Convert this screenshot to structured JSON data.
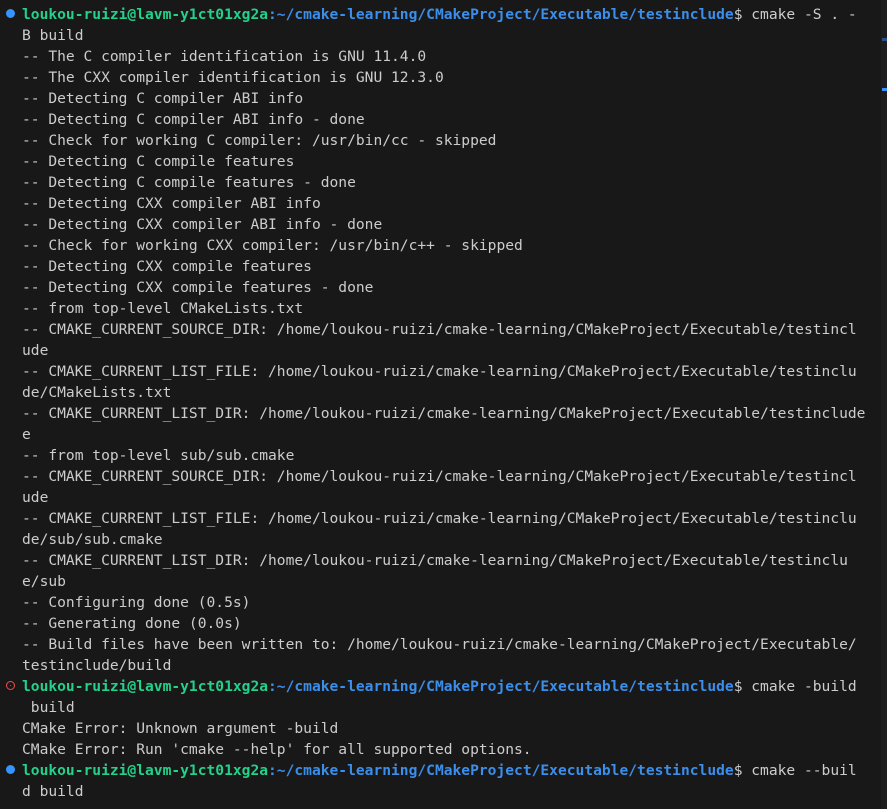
{
  "prompt": {
    "user_host": "loukou-ruizi@lavm-y1ct01xg2a",
    "path": ":~/cmake-learning/CMakeProject/Executable/testinclude",
    "dollar": "$"
  },
  "colors": {
    "prompt_user": "#23d18b",
    "prompt_path": "#3b8eea",
    "text": "#cccccc",
    "background": "#181818",
    "status_ok": "#3794ff",
    "status_error": "#f14c4c"
  },
  "lines": [
    {
      "kind": "prompt",
      "status": "ok",
      "command": " cmake -S . -"
    },
    {
      "kind": "out",
      "text": "B build"
    },
    {
      "kind": "out",
      "text": "-- The C compiler identification is GNU 11.4.0"
    },
    {
      "kind": "out",
      "text": "-- The CXX compiler identification is GNU 12.3.0"
    },
    {
      "kind": "out",
      "text": "-- Detecting C compiler ABI info"
    },
    {
      "kind": "out",
      "text": "-- Detecting C compiler ABI info - done"
    },
    {
      "kind": "out",
      "text": "-- Check for working C compiler: /usr/bin/cc - skipped"
    },
    {
      "kind": "out",
      "text": "-- Detecting C compile features"
    },
    {
      "kind": "out",
      "text": "-- Detecting C compile features - done"
    },
    {
      "kind": "out",
      "text": "-- Detecting CXX compiler ABI info"
    },
    {
      "kind": "out",
      "text": "-- Detecting CXX compiler ABI info - done"
    },
    {
      "kind": "out",
      "text": "-- Check for working CXX compiler: /usr/bin/c++ - skipped"
    },
    {
      "kind": "out",
      "text": "-- Detecting CXX compile features"
    },
    {
      "kind": "out",
      "text": "-- Detecting CXX compile features - done"
    },
    {
      "kind": "out",
      "text": "-- from top-level CMakeLists.txt"
    },
    {
      "kind": "out",
      "text": "-- CMAKE_CURRENT_SOURCE_DIR: /home/loukou-ruizi/cmake-learning/CMakeProject/Executable/testincl"
    },
    {
      "kind": "out",
      "text": "ude"
    },
    {
      "kind": "out",
      "text": "-- CMAKE_CURRENT_LIST_FILE: /home/loukou-ruizi/cmake-learning/CMakeProject/Executable/testinclu"
    },
    {
      "kind": "out",
      "text": "de/CMakeLists.txt"
    },
    {
      "kind": "out",
      "text": "-- CMAKE_CURRENT_LIST_DIR: /home/loukou-ruizi/cmake-learning/CMakeProject/Executable/testinclude"
    },
    {
      "kind": "out",
      "text": "e"
    },
    {
      "kind": "out",
      "text": "-- from top-level sub/sub.cmake"
    },
    {
      "kind": "out",
      "text": "-- CMAKE_CURRENT_SOURCE_DIR: /home/loukou-ruizi/cmake-learning/CMakeProject/Executable/testincl"
    },
    {
      "kind": "out",
      "text": "ude"
    },
    {
      "kind": "out",
      "text": "-- CMAKE_CURRENT_LIST_FILE: /home/loukou-ruizi/cmake-learning/CMakeProject/Executable/testinclu"
    },
    {
      "kind": "out",
      "text": "de/sub/sub.cmake"
    },
    {
      "kind": "out",
      "text": "-- CMAKE_CURRENT_LIST_DIR: /home/loukou-ruizi/cmake-learning/CMakeProject/Executable/testinclu"
    },
    {
      "kind": "out",
      "text": "e/sub"
    },
    {
      "kind": "out",
      "text": "-- Configuring done (0.5s)"
    },
    {
      "kind": "out",
      "text": "-- Generating done (0.0s)"
    },
    {
      "kind": "out",
      "text": "-- Build files have been written to: /home/loukou-ruizi/cmake-learning/CMakeProject/Executable/"
    },
    {
      "kind": "out",
      "text": "testinclude/build"
    },
    {
      "kind": "prompt",
      "status": "error",
      "command": " cmake -build"
    },
    {
      "kind": "out",
      "text": " build"
    },
    {
      "kind": "out",
      "text": "CMake Error: Unknown argument -build"
    },
    {
      "kind": "out",
      "text": "CMake Error: Run 'cmake --help' for all supported options."
    },
    {
      "kind": "prompt",
      "status": "ok",
      "command": " cmake --buil"
    },
    {
      "kind": "out",
      "text": "d build"
    }
  ]
}
